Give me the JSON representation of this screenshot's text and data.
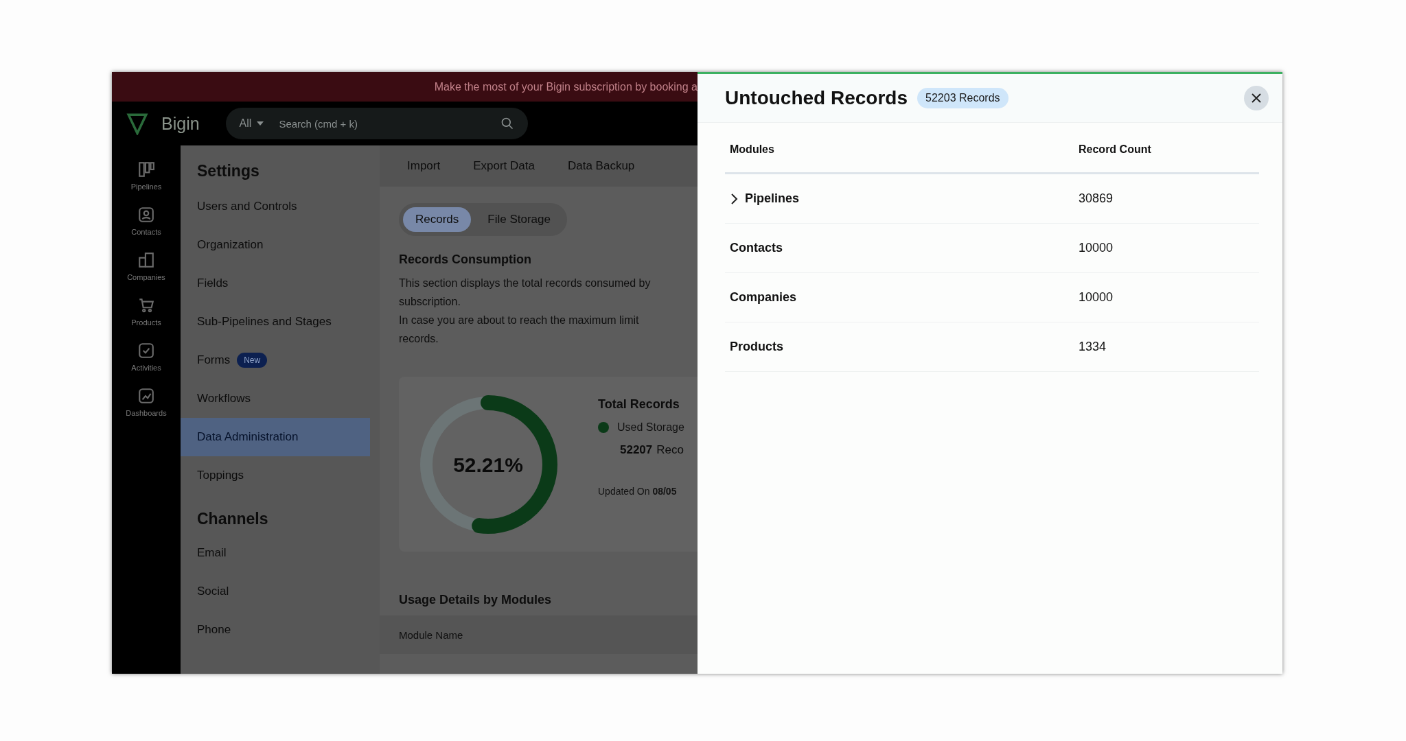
{
  "banner": {
    "text": "Make the most of your Bigin subscription by booking a"
  },
  "top_bar": {
    "logo": "Bigin",
    "scope": "All",
    "search": {
      "placeholder": "Search (cmd + k)"
    }
  },
  "nav": [
    {
      "label": "Pipelines",
      "kind": "pipelines"
    },
    {
      "label": "Contacts",
      "kind": "contacts"
    },
    {
      "label": "Companies",
      "kind": "companies"
    },
    {
      "label": "Products",
      "kind": "products"
    },
    {
      "label": "Activities",
      "kind": "activities"
    },
    {
      "label": "Dashboards",
      "kind": "dashboards"
    }
  ],
  "settings": {
    "title": "Settings",
    "items": [
      {
        "label": "Users and Controls",
        "selected": false
      },
      {
        "label": "Organization",
        "selected": false
      },
      {
        "label": "Fields",
        "selected": false
      },
      {
        "label": "Sub-Pipelines and Stages",
        "selected": false
      },
      {
        "label": "Forms",
        "badge": "New",
        "selected": false
      },
      {
        "label": "Workflows",
        "selected": false
      },
      {
        "label": "Data Administration",
        "selected": true
      },
      {
        "label": "Toppings",
        "selected": false
      }
    ],
    "channels_title": "Channels",
    "channels": [
      {
        "label": "Email",
        "selected": false
      },
      {
        "label": "Social",
        "selected": false
      },
      {
        "label": "Phone",
        "selected": false
      }
    ]
  },
  "tabs": [
    {
      "label": "Import"
    },
    {
      "label": "Export Data"
    },
    {
      "label": "Data Backup"
    }
  ],
  "segments": [
    {
      "label": "Records",
      "selected": true
    },
    {
      "label": "File Storage",
      "selected": false
    }
  ],
  "consumption": {
    "title": "Records Consumption",
    "lines": [
      "This section displays the total records consumed by",
      "subscription.",
      "In case you are about to reach the maximum limit",
      "records."
    ],
    "donut": {
      "level": 0.5221,
      "reading": "52.21%"
    },
    "total": "Total Records",
    "legend": "Used Storage",
    "used": "52207",
    "used_unit": "Reco",
    "updated": "Updated On **08/05**"
  },
  "usage": {
    "title": "Usage Details by Modules",
    "column": "Module Name"
  },
  "panel": {
    "title": "Untouched Records",
    "badge": "52203 Records",
    "columns": [
      "Modules",
      "Record Count"
    ],
    "rows": [
      {
        "module": "Pipelines",
        "count": "30869",
        "kind": "expandable"
      },
      {
        "module": "Contacts",
        "count": "10000",
        "kind": "plain"
      },
      {
        "module": "Companies",
        "count": "10000",
        "kind": "plain"
      },
      {
        "module": "Products",
        "count": "1334",
        "kind": "plain"
      }
    ]
  }
}
